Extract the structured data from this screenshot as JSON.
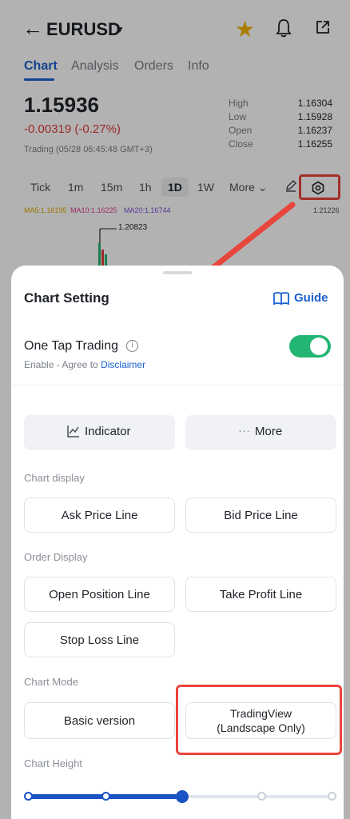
{
  "header": {
    "symbol": "EURUSD",
    "back_icon": "arrow-left-icon",
    "star_icon": "star-icon",
    "bell_icon": "bell-icon",
    "share_icon": "share-icon"
  },
  "tabs": [
    {
      "label": "Chart",
      "active": true
    },
    {
      "label": "Analysis",
      "active": false
    },
    {
      "label": "Orders",
      "active": false
    },
    {
      "label": "Info",
      "active": false
    }
  ],
  "quote": {
    "price": "1.15936",
    "change": "-0.00319 (-0.27%)",
    "trading_time": "Trading (05/28 06:45:48 GMT+3)",
    "stats": [
      {
        "label": "High",
        "value": "1.16304"
      },
      {
        "label": "Low",
        "value": "1.15928"
      },
      {
        "label": "Open",
        "value": "1.16237"
      },
      {
        "label": "Close",
        "value": "1.16255"
      }
    ]
  },
  "periods": [
    "Tick",
    "1m",
    "15m",
    "1h",
    "1D",
    "1W",
    "More"
  ],
  "selected_period": "1D",
  "chart": {
    "ma5": "MA5:1.16195",
    "ma10": "MA10:1.16225",
    "ma20": "MA20:1.16744",
    "high_label": "1.20823",
    "right_label": "1.21226",
    "colors": {
      "ma5": "#e0a800",
      "ma10": "#e03a8c",
      "ma20": "#7b4fd6"
    }
  },
  "sheet": {
    "title": "Chart Setting",
    "guide_label": "Guide",
    "one_tap": {
      "label": "One Tap Trading",
      "sub_prefix": "Enable - Agree to ",
      "sub_link": "Disclaimer",
      "enabled": true
    },
    "top_buttons": {
      "indicator": "Indicator",
      "more": "More"
    },
    "chart_display": {
      "label": "Chart display",
      "ask": "Ask Price Line",
      "bid": "Bid Price Line"
    },
    "order_display": {
      "label": "Order Display",
      "open_position": "Open Position Line",
      "take_profit": "Take Profit Line",
      "stop_loss": "Stop Loss Line"
    },
    "chart_mode": {
      "label": "Chart Mode",
      "basic": "Basic version",
      "tradingview_line1": "TradingView",
      "tradingview_line2": "(Landscape Only)"
    },
    "chart_height": {
      "label": "Chart Height",
      "steps": 5,
      "selected_step": 3
    }
  },
  "accent_colors": {
    "blue": "#1a5fd0",
    "green": "#22b573",
    "red": "#e03a3a",
    "annotation": "#e8453c"
  }
}
